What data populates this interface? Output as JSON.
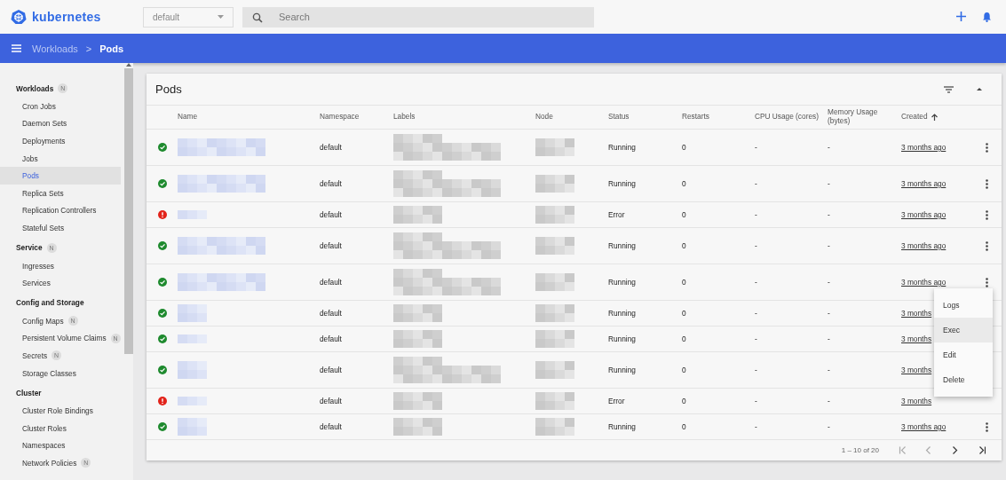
{
  "header": {
    "logo": "kubernetes",
    "namespace": "default",
    "search_placeholder": "Search"
  },
  "breadcrumb": {
    "items": [
      "Workloads",
      "Pods"
    ],
    "separator": ">"
  },
  "sidebar": {
    "sections": [
      {
        "title": "Workloads",
        "badge": "N",
        "items": [
          {
            "label": "Cron Jobs",
            "selected": false
          },
          {
            "label": "Daemon Sets",
            "selected": false
          },
          {
            "label": "Deployments",
            "selected": false
          },
          {
            "label": "Jobs",
            "selected": false
          },
          {
            "label": "Pods",
            "selected": true
          },
          {
            "label": "Replica Sets",
            "selected": false
          },
          {
            "label": "Replication Controllers",
            "selected": false
          },
          {
            "label": "Stateful Sets",
            "selected": false
          }
        ]
      },
      {
        "title": "Service",
        "badge": "N",
        "items": [
          {
            "label": "Ingresses",
            "selected": false
          },
          {
            "label": "Services",
            "selected": false
          }
        ]
      },
      {
        "title": "Config and Storage",
        "items": [
          {
            "label": "Config Maps",
            "badge": "N",
            "selected": false
          },
          {
            "label": "Persistent Volume Claims",
            "badge": "N",
            "selected": false
          },
          {
            "label": "Secrets",
            "badge": "N",
            "selected": false
          },
          {
            "label": "Storage Classes",
            "selected": false
          }
        ]
      },
      {
        "title": "Cluster",
        "items": [
          {
            "label": "Cluster Role Bindings",
            "selected": false
          },
          {
            "label": "Cluster Roles",
            "selected": false
          },
          {
            "label": "Namespaces",
            "selected": false
          },
          {
            "label": "Network Policies",
            "badge": "N",
            "selected": false
          }
        ]
      }
    ]
  },
  "pods": {
    "title": "Pods",
    "columns": [
      "Name",
      "Namespace",
      "Labels",
      "Node",
      "Status",
      "Restarts",
      "CPU Usage (cores)",
      "Memory Usage (bytes)",
      "Created"
    ],
    "rows": [
      {
        "kind": "running",
        "namespace": "default",
        "status": "Running",
        "restarts": "0",
        "cpu": "-",
        "memory": "-",
        "created": "3 months ago",
        "kebab": true
      },
      {
        "kind": "running",
        "namespace": "default",
        "status": "Running",
        "restarts": "0",
        "cpu": "-",
        "memory": "-",
        "created": "3 months ago",
        "kebab": true
      },
      {
        "kind": "error",
        "namespace": "default",
        "status": "Error",
        "restarts": "0",
        "cpu": "-",
        "memory": "-",
        "created": "3 months ago",
        "kebab": true
      },
      {
        "kind": "running",
        "namespace": "default",
        "status": "Running",
        "restarts": "0",
        "cpu": "-",
        "memory": "-",
        "created": "3 months ago",
        "kebab": true
      },
      {
        "kind": "running",
        "namespace": "default",
        "status": "Running",
        "restarts": "0",
        "cpu": "-",
        "memory": "-",
        "created": "3 months ago",
        "kebab": true
      },
      {
        "kind": "running",
        "namespace": "default",
        "status": "Running",
        "restarts": "0",
        "cpu": "-",
        "memory": "-",
        "created": "3 months",
        "kebab": false
      },
      {
        "kind": "running",
        "namespace": "default",
        "status": "Running",
        "restarts": "0",
        "cpu": "-",
        "memory": "-",
        "created": "3 months",
        "kebab": false
      },
      {
        "kind": "running",
        "namespace": "default",
        "status": "Running",
        "restarts": "0",
        "cpu": "-",
        "memory": "-",
        "created": "3 months",
        "kebab": false
      },
      {
        "kind": "error",
        "namespace": "default",
        "status": "Error",
        "restarts": "0",
        "cpu": "-",
        "memory": "-",
        "created": "3 months",
        "kebab": false
      },
      {
        "kind": "running",
        "namespace": "default",
        "status": "Running",
        "restarts": "0",
        "cpu": "-",
        "memory": "-",
        "created": "3 months ago",
        "kebab": true
      }
    ],
    "pagination": "1 – 10 of 20"
  },
  "context_menu": {
    "items": [
      {
        "label": "Logs",
        "selected": false
      },
      {
        "label": "Exec",
        "selected": true
      },
      {
        "label": "Edit",
        "selected": false
      },
      {
        "label": "Delete",
        "selected": false
      }
    ]
  }
}
